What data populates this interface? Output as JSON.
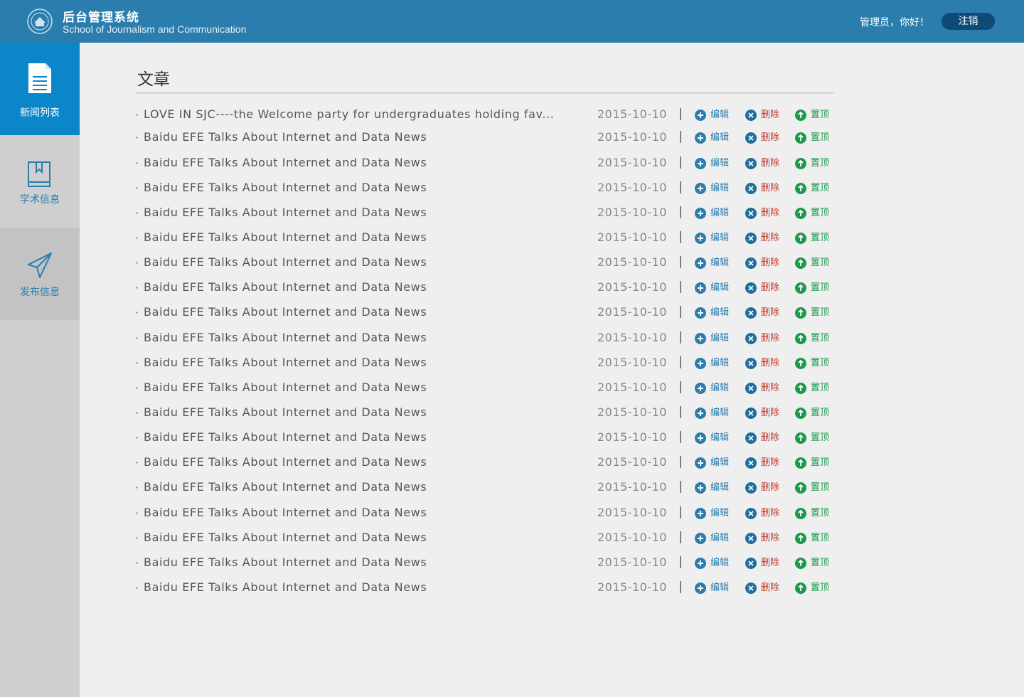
{
  "header": {
    "title": "后台管理系统",
    "subtitle": "School of Journalism and Communication",
    "greeting": "管理员，你好！",
    "logout_label": "注销",
    "bg_color": "#2a7dac",
    "logout_color": "#0e4a78"
  },
  "sidebar": {
    "items": [
      {
        "label": "新闻列表",
        "icon": "document-icon",
        "active": true
      },
      {
        "label": "学术信息",
        "icon": "book-icon",
        "active": false
      },
      {
        "label": "发布信息",
        "icon": "send-icon",
        "active": false
      }
    ],
    "active_color": "#0b87c9"
  },
  "main": {
    "title": "文章",
    "actions": {
      "edit": "编辑",
      "delete": "删除",
      "pin": "置顶",
      "edit_color": "#2a7dac",
      "delete_color": "#c0392b",
      "pin_color": "#1a9a4a"
    },
    "articles": [
      {
        "title": "LOVE IN SJC----the Welcome party for undergraduates holding fav...",
        "date": "2015-10-10"
      },
      {
        "title": "Baidu EFE Talks About Internet and Data News",
        "date": "2015-10-10"
      },
      {
        "title": "Baidu EFE Talks About Internet and Data News",
        "date": "2015-10-10"
      },
      {
        "title": "Baidu EFE Talks About Internet and Data News",
        "date": "2015-10-10"
      },
      {
        "title": "Baidu EFE Talks About Internet and Data News",
        "date": "2015-10-10"
      },
      {
        "title": "Baidu EFE Talks About Internet and Data News",
        "date": "2015-10-10"
      },
      {
        "title": "Baidu EFE Talks About Internet and Data News",
        "date": "2015-10-10"
      },
      {
        "title": "Baidu EFE Talks About Internet and Data News",
        "date": "2015-10-10"
      },
      {
        "title": "Baidu EFE Talks About Internet and Data News",
        "date": "2015-10-10"
      },
      {
        "title": "Baidu EFE Talks About Internet and Data News",
        "date": "2015-10-10"
      },
      {
        "title": "Baidu EFE Talks About Internet and Data News",
        "date": "2015-10-10"
      },
      {
        "title": "Baidu EFE Talks About Internet and Data News",
        "date": "2015-10-10"
      },
      {
        "title": "Baidu EFE Talks About Internet and Data News",
        "date": "2015-10-10"
      },
      {
        "title": "Baidu EFE Talks About Internet and Data News",
        "date": "2015-10-10"
      },
      {
        "title": "Baidu EFE Talks About Internet and Data News",
        "date": "2015-10-10"
      },
      {
        "title": "Baidu EFE Talks About Internet and Data News",
        "date": "2015-10-10"
      },
      {
        "title": "Baidu EFE Talks About Internet and Data News",
        "date": "2015-10-10"
      },
      {
        "title": "Baidu EFE Talks About Internet and Data News",
        "date": "2015-10-10"
      },
      {
        "title": "Baidu EFE Talks About Internet and Data News",
        "date": "2015-10-10"
      },
      {
        "title": "Baidu EFE Talks About Internet and Data News",
        "date": "2015-10-10"
      }
    ]
  }
}
